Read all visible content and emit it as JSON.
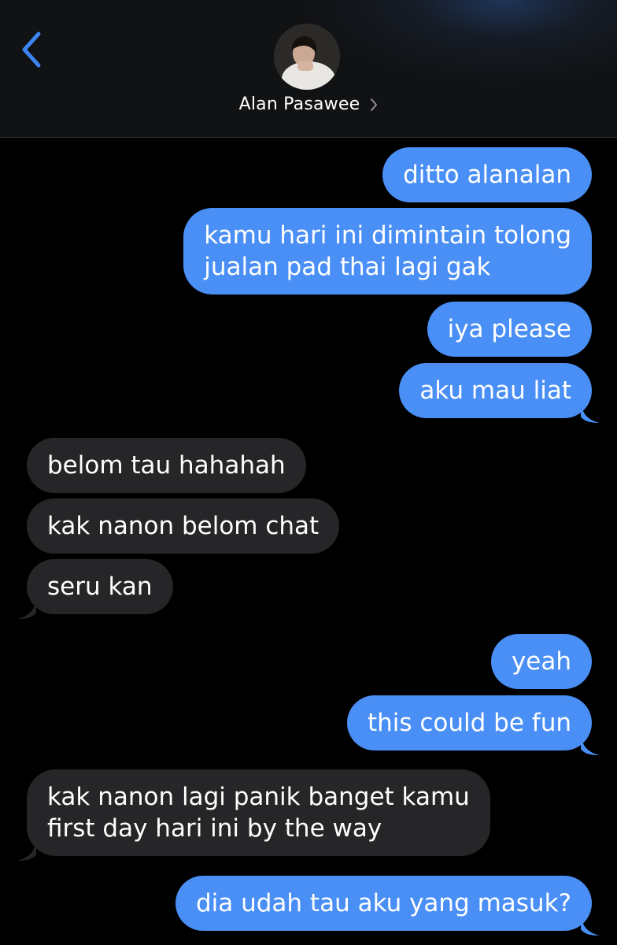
{
  "header": {
    "contact_name": "Alan Pasawee",
    "back_icon": "chevron-left-icon",
    "disclosure_icon": "chevron-right-icon",
    "accent": "#4a8ff5"
  },
  "colors": {
    "outgoing_bubble": "#4a8ff5",
    "incoming_bubble": "#262628",
    "background": "#000000"
  },
  "messages": [
    {
      "direction": "out",
      "lines": [
        "ditto alanalan"
      ]
    },
    {
      "direction": "out",
      "lines": [
        "kamu hari ini dimintain tolong",
        "jualan pad thai lagi gak"
      ]
    },
    {
      "direction": "out",
      "lines": [
        "iya please"
      ]
    },
    {
      "direction": "out",
      "lines": [
        "aku mau liat"
      ]
    },
    {
      "direction": "in",
      "lines": [
        "belom tau hahahah"
      ]
    },
    {
      "direction": "in",
      "lines": [
        "kak nanon belom chat"
      ]
    },
    {
      "direction": "in",
      "lines": [
        "seru kan"
      ]
    },
    {
      "direction": "out",
      "lines": [
        "yeah"
      ]
    },
    {
      "direction": "out",
      "lines": [
        "this could be fun"
      ]
    },
    {
      "direction": "in",
      "lines": [
        "kak nanon lagi panik banget kamu",
        "first day hari ini by the way"
      ]
    },
    {
      "direction": "out",
      "lines": [
        "dia udah tau aku yang masuk?"
      ]
    }
  ]
}
